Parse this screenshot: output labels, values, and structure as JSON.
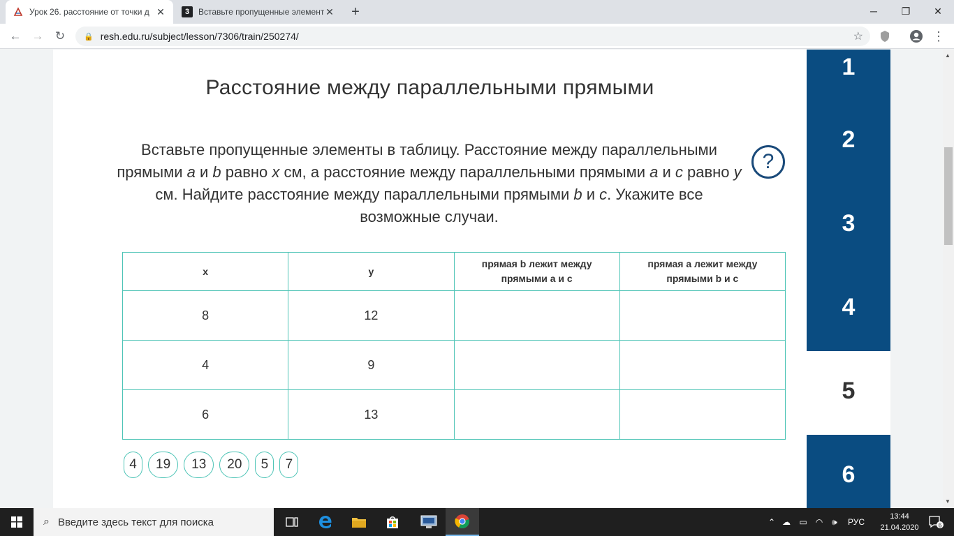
{
  "browser": {
    "tabs": [
      {
        "title": "Урок 26. расстояние от точки д",
        "active": true
      },
      {
        "title": "Вставьте пропущенные элемент",
        "active": false,
        "favicon_text": "3"
      }
    ],
    "new_tab": "+",
    "window_controls": {
      "minimize": "─",
      "maximize": "❐",
      "close": "✕"
    },
    "nav": {
      "back": "←",
      "forward": "→",
      "reload": "↻"
    },
    "url": "resh.edu.ru/subject/lesson/7306/train/250274/"
  },
  "page": {
    "heading": "Расстояние между параллельными прямыми",
    "task": {
      "p1": "Вставьте пропущенные элементы в таблицу. Расстояние между параллельными прямыми ",
      "a1": "a",
      "p2": " и ",
      "b1": "b",
      "p3": " равно ",
      "x": "x",
      "p4": " см, а расстояние между параллельными прямыми ",
      "a2": "a",
      "p5": " и ",
      "c1": "c",
      "p6": " равно ",
      "y": "y",
      "p7": " см. Найдите расстояние между параллельными прямыми ",
      "b2": "b",
      "p8": " и ",
      "c2": "c",
      "p9": ". Укажите все возможные случаи."
    },
    "help_label": "?",
    "table": {
      "headers": [
        "x",
        "y",
        "прямая b лежит между прямыми a и c",
        "прямая a лежит между прямыми b и c"
      ],
      "rows": [
        [
          "8",
          "12",
          "",
          ""
        ],
        [
          "4",
          "9",
          "",
          ""
        ],
        [
          "6",
          "13",
          "",
          ""
        ]
      ]
    },
    "answer_chips": [
      "4",
      "19",
      "13",
      "20",
      "5",
      "7"
    ],
    "steps": [
      {
        "label": "1",
        "current": false
      },
      {
        "label": "2",
        "current": false
      },
      {
        "label": "3",
        "current": false
      },
      {
        "label": "4",
        "current": false
      },
      {
        "label": "5",
        "current": true
      },
      {
        "label": "6",
        "current": false
      }
    ]
  },
  "taskbar": {
    "search_placeholder": "Введите здесь текст для поиска",
    "language": "РУС",
    "time": "13:44",
    "date": "21.04.2020",
    "notifications": "6"
  }
}
